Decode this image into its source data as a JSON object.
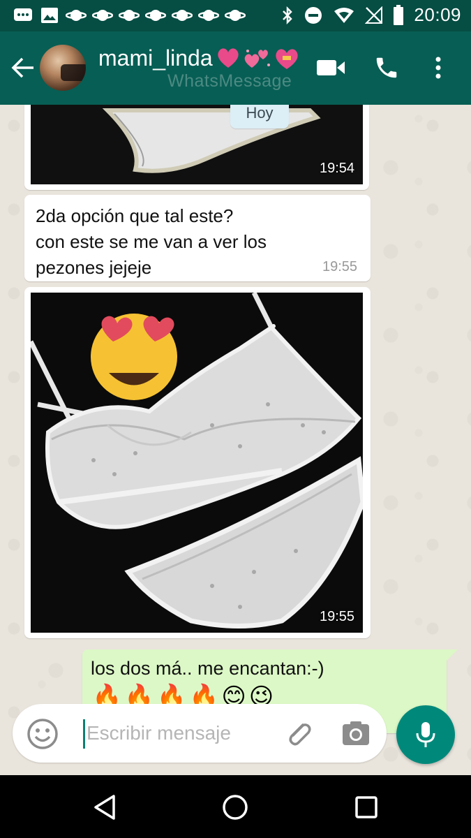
{
  "status_bar": {
    "time": "20:09",
    "left_icons": [
      "chat-notification-icon",
      "image-notification-icon",
      "planet-icon",
      "planet-icon",
      "planet-icon",
      "planet-icon",
      "planet-icon",
      "planet-icon",
      "planet-icon"
    ],
    "right_icons": [
      "bluetooth-icon",
      "do-not-disturb-icon",
      "wifi-icon",
      "no-signal-icon",
      "battery-icon"
    ]
  },
  "header": {
    "contact_name": "mami_linda",
    "name_emojis": [
      "💗",
      "💞",
      "💝"
    ],
    "watermark": "WhatsMessage",
    "actions": [
      "video-call-icon",
      "phone-icon",
      "more-options-icon"
    ]
  },
  "chat": {
    "day_label": "Hoy",
    "messages": [
      {
        "type": "image",
        "direction": "in",
        "time": "19:54"
      },
      {
        "type": "text",
        "direction": "in",
        "text": "2da opción que tal este?\ncon este se me van a ver los\npezones jejeje",
        "time": "19:55"
      },
      {
        "type": "image",
        "direction": "in",
        "sticker": "😍",
        "time": "19:55"
      },
      {
        "type": "text",
        "direction": "out",
        "text": "los dos má.. me encantan:-)",
        "emojis": "🔥🔥🔥🔥😊😉"
      }
    ]
  },
  "composer": {
    "placeholder": "Escribir mensaje",
    "icons": [
      "emoji-icon",
      "attach-icon",
      "camera-icon",
      "mic-icon"
    ]
  },
  "colors": {
    "status_bar": "#064d43",
    "app_bar": "#075e54",
    "outgoing_bubble": "#dcf8c6",
    "accent": "#00897b"
  }
}
